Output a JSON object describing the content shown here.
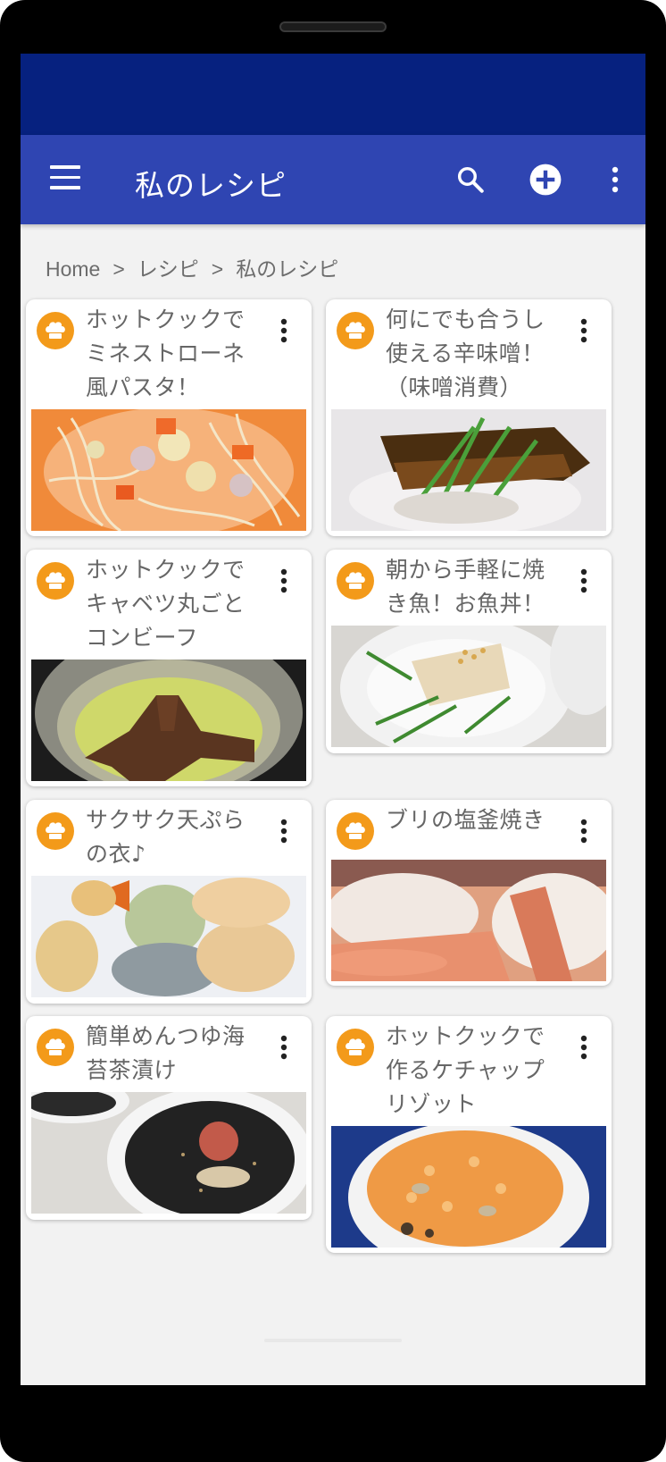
{
  "app": {
    "title": "私のレシピ",
    "icons": {
      "menu": "menu-icon",
      "search": "search-icon",
      "add": "add-circle-icon",
      "more": "more-vert-icon"
    }
  },
  "colors": {
    "status_bar": "#06217f",
    "app_bar": "#2f45b2",
    "background": "#f2f2f2",
    "avatar": "#f39a1a"
  },
  "breadcrumb": {
    "items": [
      "Home",
      "レシピ",
      "私のレシピ"
    ],
    "separator": ">"
  },
  "recipes": [
    {
      "title": "ホットクックでミネストローネ風パスタ！",
      "avatar_icon": "chef-hat-icon",
      "menu_icon": "more-vert-icon"
    },
    {
      "title": "何にでも合うし使える辛味噌！（味噌消費）",
      "avatar_icon": "chef-hat-icon",
      "menu_icon": "more-vert-icon"
    },
    {
      "title": "ホットクックでキャベツ丸ごとコンビーフ",
      "avatar_icon": "chef-hat-icon",
      "menu_icon": "more-vert-icon"
    },
    {
      "title": "朝から手軽に焼き魚！お魚丼！",
      "avatar_icon": "chef-hat-icon",
      "menu_icon": "more-vert-icon"
    },
    {
      "title": "サクサク天ぷらの衣♪",
      "avatar_icon": "chef-hat-icon",
      "menu_icon": "more-vert-icon"
    },
    {
      "title": "ブリの塩釜焼き",
      "avatar_icon": "chef-hat-icon",
      "menu_icon": "more-vert-icon"
    },
    {
      "title": "簡単めんつゆ海苔茶漬け",
      "avatar_icon": "chef-hat-icon",
      "menu_icon": "more-vert-icon"
    },
    {
      "title": "ホットクックで作るケチャップリゾット",
      "avatar_icon": "chef-hat-icon",
      "menu_icon": "more-vert-icon"
    }
  ]
}
